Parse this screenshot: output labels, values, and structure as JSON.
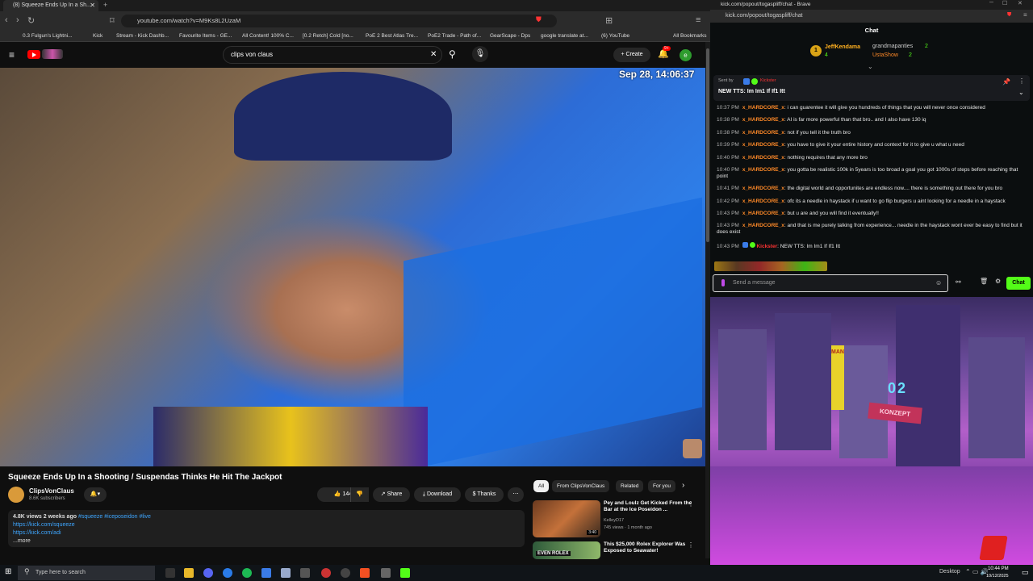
{
  "left_browser": {
    "tab_title": "(8) Squeeze Ends Up In a Sh...",
    "url": "youtube.com/watch?v=M9Ks8L2UzaM",
    "bookmarks": [
      "0.3 Fulgun's Lightni...",
      "Kick",
      "Stream - Kick Dashb...",
      "Favourite Items - GE...",
      "All Content! 100% C...",
      "[0.2 Retch] Cold [no...",
      "PoE 2 Best Atlas Tre...",
      "PoE2 Trade - Path of...",
      "GearScape - Dps",
      "google translate at...",
      "(6) YouTube",
      "All Bookmarks"
    ],
    "search_query": "clips von claus",
    "create_label": "Create",
    "notification_count": "9+",
    "avatar_letter": "e"
  },
  "video": {
    "timestamp_overlay": "Sep 28, 14:06:37",
    "title": "Squeeze Ends Up In a Shooting / Suspendas Thinks He Hit The Jackpot",
    "channel_name": "ClipsVonClaus",
    "subscribers": "8.6K subscribers",
    "likes": "144",
    "share_label": "Share",
    "download_label": "Download",
    "thanks_label": "Thanks",
    "views_date": "4.8K views  2 weeks ago",
    "hashtags": "#squeeze #iceposeidon #live",
    "links": [
      "https://kick.com/squeeze",
      "https://kick.com/adi"
    ],
    "more_label": "...more"
  },
  "recommendation_chips": [
    "All",
    "From ClipsVonClaus",
    "Related",
    "For you"
  ],
  "recommendations": [
    {
      "title": "Pey and Loulz Get Kicked From the Bar at the Ice Poseidon ...",
      "channel": "KelleyD17",
      "meta": "745 views · 1 month ago",
      "duration": "3:40"
    },
    {
      "title": "This $25,000 Rolex Explorer Was Exposed to Seawater!",
      "channel": "",
      "meta": "",
      "duration": "",
      "thumb_text": "EVEN ROLEX"
    }
  ],
  "taskbar": {
    "search_placeholder": "Type here to search",
    "desktop_label": "Desktop",
    "time": "10:44 PM",
    "date": "10/12/2025"
  },
  "right_browser": {
    "window_title": "kick.com/popout/togaspliff/chat - Brave",
    "url": "kick.com/popout/togaspliff/chat",
    "chat_header": "Chat",
    "gifters": [
      {
        "name": "JeffKendama",
        "count": "4",
        "rank": "1"
      },
      {
        "name": "grandmapanties",
        "count": "2"
      },
      {
        "name": "UstaShow",
        "count": "2"
      }
    ],
    "pinned": {
      "sent_by_label": "Sent by",
      "sender": "Kickster",
      "text": "NEW TTS: Im Im1 If If1 Itt"
    },
    "messages": [
      {
        "time": "10:37 PM",
        "user": "x_HARDCORE_x",
        "text": "i can guarentee it will give you hundreds of things that you will never once considered"
      },
      {
        "time": "10:38 PM",
        "user": "x_HARDCORE_x",
        "text": "AI is far more powerful than that bro.. and I also have 130 iq"
      },
      {
        "time": "10:38 PM",
        "user": "x_HARDCORE_x",
        "text": "not if you tell it the truth bro"
      },
      {
        "time": "10:39 PM",
        "user": "x_HARDCORE_x",
        "text": "you have to give it your entire history and context for it to give u what u need"
      },
      {
        "time": "10:40 PM",
        "user": "x_HARDCORE_x",
        "text": "nothing requires that any more bro"
      },
      {
        "time": "10:40 PM",
        "user": "x_HARDCORE_x",
        "text": "you gotta be realistic 100k in 5years is too broad a goal you got 1000s of steps before reaching that point"
      },
      {
        "time": "10:41 PM",
        "user": "x_HARDCORE_x",
        "text": "the digital world and opportunites are endless now.... there is something out there for you bro"
      },
      {
        "time": "10:42 PM",
        "user": "x_HARDCORE_x",
        "text": "ofc its a needle in haystack if u want to go flip burgers u aint looking for a needle in a haystack"
      },
      {
        "time": "10:43 PM",
        "user": "x_HARDCORE_x",
        "text": "but u are and you will find it eventually!!"
      },
      {
        "time": "10:43 PM",
        "user": "x_HARDCORE_x",
        "text": "and that is me purely talking from experience... needle in the haystack wont ever be easy to find but it does exist"
      },
      {
        "time": "10:43 PM",
        "user": "Kickster",
        "text": "NEW TTS: Im Im1 If If1 Itt"
      }
    ],
    "input_placeholder": "Send a message",
    "chat_button": "Chat",
    "stream_signs": [
      "MAN",
      "02",
      "KONZEPT"
    ]
  },
  "colors": {
    "kick_green": "#53fc18",
    "youtube_red": "#ff0000",
    "chat_username": "#ff8a28",
    "link_blue": "#3ea6ff"
  }
}
